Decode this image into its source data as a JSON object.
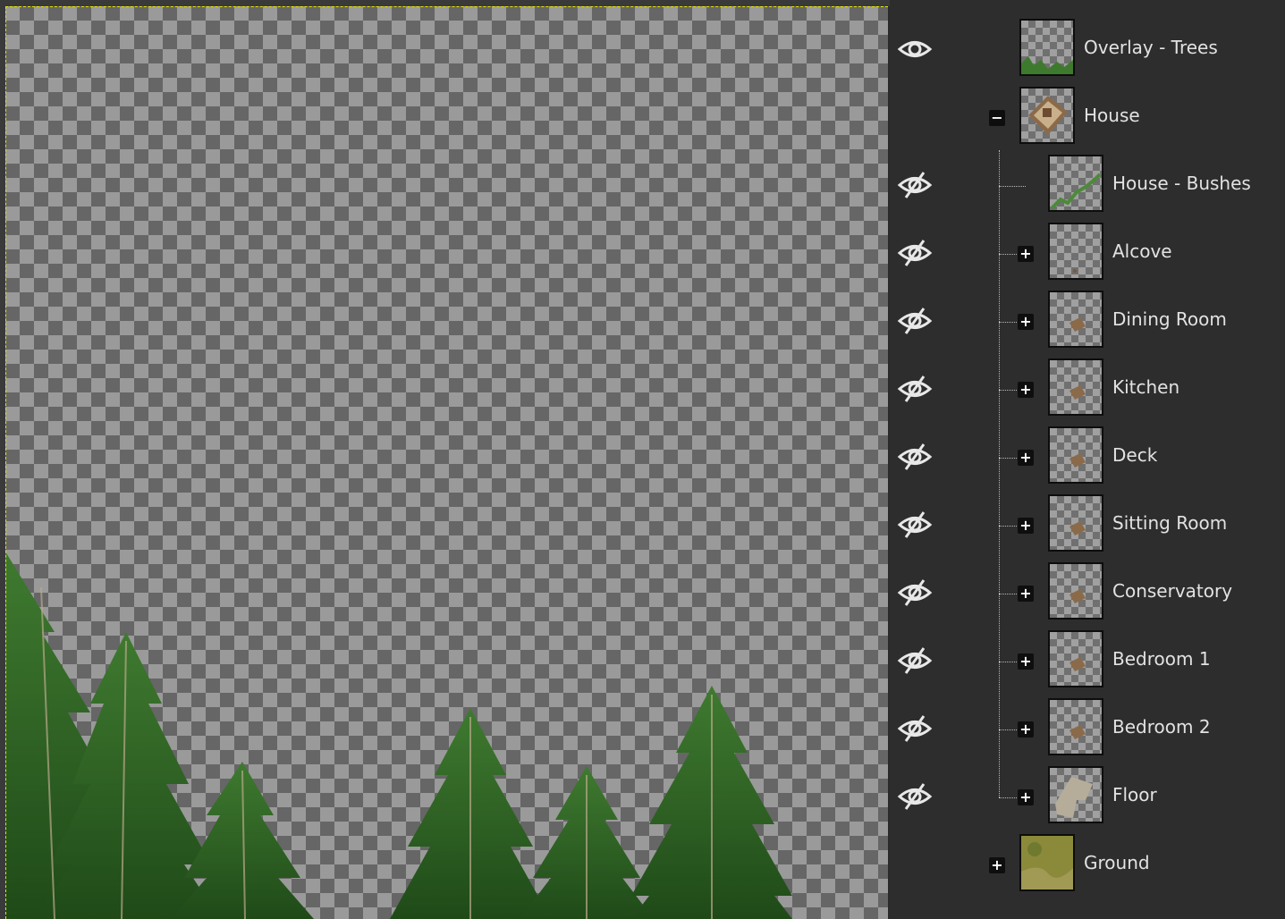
{
  "canvas": {
    "icons": [
      "pine-tree-icon"
    ]
  },
  "layers_panel": {
    "layers": [
      {
        "name": "Overlay - Trees",
        "visible": true,
        "indent": 0,
        "toggle": "",
        "thumb": "trees"
      },
      {
        "name": "House",
        "visible": null,
        "indent": 0,
        "toggle": "−",
        "thumb": "house"
      },
      {
        "name": "House - Bushes",
        "visible": false,
        "indent": 1,
        "toggle": "",
        "thumb": "bushes"
      },
      {
        "name": "Alcove",
        "visible": false,
        "indent": 1,
        "toggle": "+",
        "thumb": "dot"
      },
      {
        "name": "Dining Room",
        "visible": false,
        "indent": 1,
        "toggle": "+",
        "thumb": "small"
      },
      {
        "name": "Kitchen",
        "visible": false,
        "indent": 1,
        "toggle": "+",
        "thumb": "small"
      },
      {
        "name": "Deck",
        "visible": false,
        "indent": 1,
        "toggle": "+",
        "thumb": "small"
      },
      {
        "name": "Sitting Room",
        "visible": false,
        "indent": 1,
        "toggle": "+",
        "thumb": "small"
      },
      {
        "name": "Conservatory",
        "visible": false,
        "indent": 1,
        "toggle": "+",
        "thumb": "small"
      },
      {
        "name": "Bedroom 1",
        "visible": false,
        "indent": 1,
        "toggle": "+",
        "thumb": "small"
      },
      {
        "name": "Bedroom 2",
        "visible": false,
        "indent": 1,
        "toggle": "+",
        "thumb": "small"
      },
      {
        "name": "Floor",
        "visible": false,
        "indent": 1,
        "toggle": "+",
        "thumb": "floor"
      },
      {
        "name": "Ground",
        "visible": null,
        "indent": 0,
        "toggle": "+",
        "thumb": "ground"
      }
    ]
  },
  "colors": {
    "panel_bg": "#2d2d2d",
    "selection_border": "#e6e600",
    "text": "#e2e2e2"
  }
}
